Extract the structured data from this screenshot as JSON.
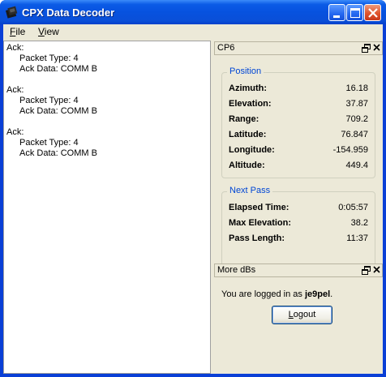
{
  "window": {
    "title": "CPX Data Decoder"
  },
  "menu": {
    "file_rest": "ile",
    "file_key": "F",
    "view_rest": "iew",
    "view_key": "V"
  },
  "log": [
    {
      "heading": "Ack:",
      "packet_type": "Packet Type: 4",
      "ack_data": "Ack Data: COMM B"
    },
    {
      "heading": "Ack:",
      "packet_type": "Packet Type: 4",
      "ack_data": "Ack Data: COMM B"
    },
    {
      "heading": "Ack:",
      "packet_type": "Packet Type: 4",
      "ack_data": "Ack Data: COMM B"
    }
  ],
  "cp6": {
    "title": "CP6",
    "position": {
      "label": "Position",
      "rows": [
        {
          "label": "Azimuth:",
          "value": "16.18"
        },
        {
          "label": "Elevation:",
          "value": "37.87"
        },
        {
          "label": "Range:",
          "value": "709.2"
        },
        {
          "label": "Latitude:",
          "value": "76.847"
        },
        {
          "label": "Longitude:",
          "value": "-154.959"
        },
        {
          "label": "Altitude:",
          "value": "449.4"
        }
      ]
    },
    "next_pass": {
      "label": "Next Pass",
      "rows": [
        {
          "label": "Elapsed Time:",
          "value": "0:05:57"
        },
        {
          "label": "Max Elevation:",
          "value": "38.2"
        },
        {
          "label": "Pass Length:",
          "value": "11:37"
        }
      ]
    }
  },
  "more_dbs": {
    "title": "More dBs",
    "logged_in_prefix": "You are logged in as ",
    "username": "je9pel",
    "suffix": ".",
    "logout_key": "L",
    "logout_rest": "ogout"
  },
  "icons": {
    "app": "cpx-app-icon",
    "minimize": "minimize-icon",
    "maximize": "maximize-icon",
    "close": "close-icon",
    "float": "float-window-icon",
    "panel_close": "panel-close-icon"
  },
  "colors": {
    "titlebar": "#0752df",
    "client_bg": "#ece9d8",
    "group_label": "#0046d5"
  }
}
